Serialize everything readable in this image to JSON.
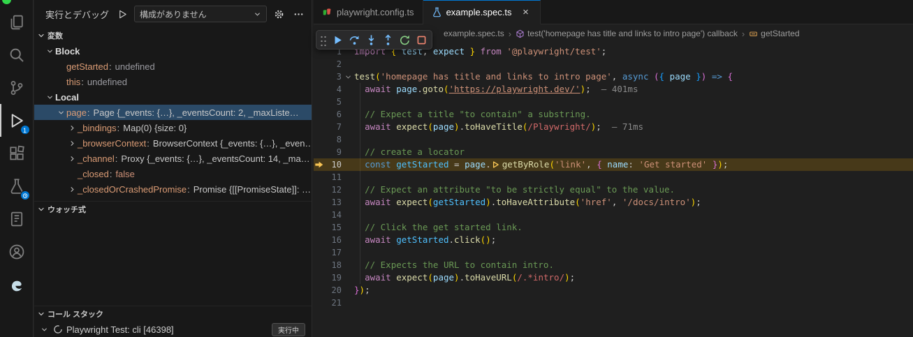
{
  "theme": {
    "accent": "#0078d4",
    "editor_bg": "#1f1f1f",
    "sidebar_bg": "#181818",
    "selection_bg": "#2b4a67",
    "current_line_bg": "#4a3a12",
    "stackframe_arrow": "#f8c555"
  },
  "activity_bar": {
    "items": [
      {
        "id": "explorer"
      },
      {
        "id": "search"
      },
      {
        "id": "source-control"
      },
      {
        "id": "run-debug",
        "active": true,
        "badge": "1"
      },
      {
        "id": "extensions"
      },
      {
        "id": "testing",
        "badge_clock": true
      },
      {
        "id": "notebook"
      },
      {
        "id": "account"
      },
      {
        "id": "edge"
      }
    ]
  },
  "sidebar": {
    "title": "実行とデバッグ",
    "toolbar": {
      "config_dropdown": "構成がありません"
    },
    "variables": {
      "header": "変数",
      "rows": [
        {
          "kind": "scope",
          "name": "Block",
          "chevron": "expanded",
          "indent": 0
        },
        {
          "kind": "var",
          "name": "getStarted",
          "value": "undefined",
          "vclass": "undef",
          "indent": 1
        },
        {
          "kind": "var",
          "name": "this",
          "value": "undefined",
          "vclass": "undef",
          "indent": 1
        },
        {
          "kind": "scope",
          "name": "Local",
          "chevron": "expanded",
          "indent": 0
        },
        {
          "kind": "var",
          "name": "page",
          "value": "Page {_events: {…}, _eventsCount: 2, _maxListe…",
          "chevron": "expanded",
          "selected": true,
          "indent": 1
        },
        {
          "kind": "var",
          "name": "_bindings",
          "value": "Map(0) {size: 0}",
          "chevron": "collapsed",
          "indent": 2
        },
        {
          "kind": "var",
          "name": "_browserContext",
          "value": "BrowserContext {_events: {…}, _even…",
          "chevron": "collapsed",
          "indent": 2
        },
        {
          "kind": "var",
          "name": "_channel",
          "value": "Proxy {_events: {…}, _eventsCount: 14, _ma…",
          "chevron": "collapsed",
          "indent": 2
        },
        {
          "kind": "var",
          "name": "_closed",
          "value": "false",
          "vclass": "bool",
          "indent": 2
        },
        {
          "kind": "var",
          "name": "_closedOrCrashedPromise",
          "value": "Promise {[[PromiseState]]: …",
          "chevron": "collapsed",
          "indent": 2
        }
      ]
    },
    "watch": {
      "header": "ウォッチ式"
    },
    "call_stack": {
      "header": "コール スタック",
      "session": "Playwright Test: cli [46398]",
      "status_badge": "実行中"
    }
  },
  "editor": {
    "tabs": [
      {
        "label": "playwright.config.ts",
        "icon": "playwright",
        "active": false
      },
      {
        "label": "example.spec.ts",
        "icon": "beaker",
        "active": true,
        "close": "×"
      }
    ],
    "breadcrumb": [
      {
        "label": "example.spec.ts"
      },
      {
        "label": "test('homepage has title and links to intro page') callback",
        "icon": "symbol-method"
      },
      {
        "label": "getStarted",
        "icon": "symbol-variable"
      }
    ],
    "debug_toolbar": [
      "continue",
      "step-over",
      "step-into",
      "step-out",
      "restart",
      "stop"
    ],
    "code": {
      "current_line": 10,
      "lines": [
        {
          "n": 1,
          "t": [
            [
              "kw",
              "import"
            ],
            [
              "pln",
              " "
            ],
            [
              "b1",
              "{"
            ],
            [
              "pln",
              " "
            ],
            [
              "var",
              "test"
            ],
            [
              "pln",
              ", "
            ],
            [
              "var",
              "expect"
            ],
            [
              "pln",
              " "
            ],
            [
              "b1",
              "}"
            ],
            [
              "pln",
              " "
            ],
            [
              "kw",
              "from"
            ],
            [
              "pln",
              " "
            ],
            [
              "str",
              "'@playwright/test'"
            ],
            [
              "pln",
              ";"
            ]
          ]
        },
        {
          "n": 2,
          "t": []
        },
        {
          "n": 3,
          "fold": true,
          "t": [
            [
              "fn",
              "test"
            ],
            [
              "b1",
              "("
            ],
            [
              "str",
              "'homepage has title and links to intro page'"
            ],
            [
              "pln",
              ", "
            ],
            [
              "kw2",
              "async"
            ],
            [
              "pln",
              " "
            ],
            [
              "b2",
              "("
            ],
            [
              "b3",
              "{"
            ],
            [
              "pln",
              " "
            ],
            [
              "var",
              "page"
            ],
            [
              "pln",
              " "
            ],
            [
              "b3",
              "}"
            ],
            [
              "b2",
              ")"
            ],
            [
              "pln",
              " "
            ],
            [
              "kw2",
              "=>"
            ],
            [
              "pln",
              " "
            ],
            [
              "b2",
              "{"
            ]
          ]
        },
        {
          "n": 4,
          "t": [
            [
              "pln",
              "  "
            ],
            [
              "kw",
              "await"
            ],
            [
              "pln",
              " "
            ],
            [
              "var",
              "page"
            ],
            [
              "pln",
              "."
            ],
            [
              "fn",
              "goto"
            ],
            [
              "b1",
              "("
            ],
            [
              "lnk",
              "'https://playwright.dev/'"
            ],
            [
              "b1",
              ")"
            ],
            [
              "pln",
              ";"
            ],
            [
              "dim",
              "  — 401ms"
            ]
          ]
        },
        {
          "n": 5,
          "t": []
        },
        {
          "n": 6,
          "t": [
            [
              "pln",
              "  "
            ],
            [
              "cmt",
              "// Expect a title \"to contain\" a substring."
            ]
          ]
        },
        {
          "n": 7,
          "t": [
            [
              "pln",
              "  "
            ],
            [
              "kw",
              "await"
            ],
            [
              "pln",
              " "
            ],
            [
              "fn",
              "expect"
            ],
            [
              "b1",
              "("
            ],
            [
              "var",
              "page"
            ],
            [
              "b1",
              ")"
            ],
            [
              "pln",
              "."
            ],
            [
              "fn",
              "toHaveTitle"
            ],
            [
              "b1",
              "("
            ],
            [
              "rx",
              "/Playwright/"
            ],
            [
              "b1",
              ")"
            ],
            [
              "pln",
              ";"
            ],
            [
              "dim",
              "  — 71ms"
            ]
          ]
        },
        {
          "n": 8,
          "t": []
        },
        {
          "n": 9,
          "t": [
            [
              "pln",
              "  "
            ],
            [
              "cmt",
              "// create a locator"
            ]
          ]
        },
        {
          "n": 10,
          "t": [
            [
              "pln",
              "  "
            ],
            [
              "kw2",
              "const"
            ],
            [
              "pln",
              " "
            ],
            [
              "cst",
              "getStarted"
            ],
            [
              "pln",
              " = "
            ],
            [
              "var",
              "page"
            ],
            [
              "pln",
              "."
            ],
            [
              "ibp",
              ""
            ],
            [
              "fn",
              "getByRole"
            ],
            [
              "b1",
              "("
            ],
            [
              "str",
              "'link'"
            ],
            [
              "pln",
              ", "
            ],
            [
              "b2",
              "{"
            ],
            [
              "pln",
              " "
            ],
            [
              "var",
              "name"
            ],
            [
              "pln",
              ": "
            ],
            [
              "str",
              "'Get started'"
            ],
            [
              "pln",
              " "
            ],
            [
              "b2",
              "}"
            ],
            [
              "b1",
              ")"
            ],
            [
              "pln",
              ";"
            ]
          ]
        },
        {
          "n": 11,
          "t": []
        },
        {
          "n": 12,
          "t": [
            [
              "pln",
              "  "
            ],
            [
              "cmt",
              "// Expect an attribute \"to be strictly equal\" to the value."
            ]
          ]
        },
        {
          "n": 13,
          "t": [
            [
              "pln",
              "  "
            ],
            [
              "kw",
              "await"
            ],
            [
              "pln",
              " "
            ],
            [
              "fn",
              "expect"
            ],
            [
              "b1",
              "("
            ],
            [
              "cst",
              "getStarted"
            ],
            [
              "b1",
              ")"
            ],
            [
              "pln",
              "."
            ],
            [
              "fn",
              "toHaveAttribute"
            ],
            [
              "b1",
              "("
            ],
            [
              "str",
              "'href'"
            ],
            [
              "pln",
              ", "
            ],
            [
              "str",
              "'/docs/intro'"
            ],
            [
              "b1",
              ")"
            ],
            [
              "pln",
              ";"
            ]
          ]
        },
        {
          "n": 14,
          "t": []
        },
        {
          "n": 15,
          "t": [
            [
              "pln",
              "  "
            ],
            [
              "cmt",
              "// Click the get started link."
            ]
          ]
        },
        {
          "n": 16,
          "t": [
            [
              "pln",
              "  "
            ],
            [
              "kw",
              "await"
            ],
            [
              "pln",
              " "
            ],
            [
              "cst",
              "getStarted"
            ],
            [
              "pln",
              "."
            ],
            [
              "fn",
              "click"
            ],
            [
              "b1",
              "()"
            ],
            [
              "pln",
              ";"
            ]
          ]
        },
        {
          "n": 17,
          "t": []
        },
        {
          "n": 18,
          "t": [
            [
              "pln",
              "  "
            ],
            [
              "cmt",
              "// Expects the URL to contain intro."
            ]
          ]
        },
        {
          "n": 19,
          "t": [
            [
              "pln",
              "  "
            ],
            [
              "kw",
              "await"
            ],
            [
              "pln",
              " "
            ],
            [
              "fn",
              "expect"
            ],
            [
              "b1",
              "("
            ],
            [
              "var",
              "page"
            ],
            [
              "b1",
              ")"
            ],
            [
              "pln",
              "."
            ],
            [
              "fn",
              "toHaveURL"
            ],
            [
              "b1",
              "("
            ],
            [
              "rx",
              "/.*intro/"
            ],
            [
              "b1",
              ")"
            ],
            [
              "pln",
              ";"
            ]
          ]
        },
        {
          "n": 20,
          "t": [
            [
              "b2",
              "}"
            ],
            [
              "b1",
              ")"
            ],
            [
              "pln",
              ";"
            ]
          ]
        },
        {
          "n": 21,
          "t": []
        }
      ]
    }
  }
}
